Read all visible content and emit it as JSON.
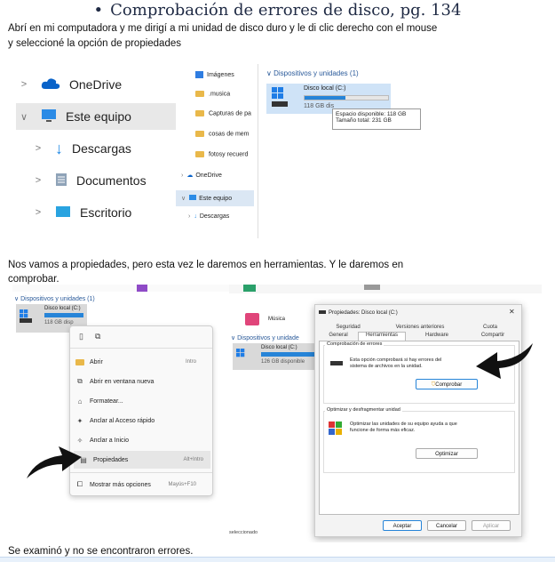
{
  "heading": {
    "bullet": "•",
    "title": "Comprobación de errores de disco, pg. 134"
  },
  "paragraphs": {
    "p1_line1": "Abrí en mi computadora y me dirigí a mi unidad de disco duro y le di clic derecho con el mouse",
    "p1_line2": "y seleccioné la opción de propiedades",
    "p2_line1": "Nos vamos a propiedades, pero esta vez le daremos en herramientas. Y le daremos en",
    "p2_line2": "comprobar.",
    "p3": "Se examinó y no se encontraron errores."
  },
  "explorer_big": {
    "items": [
      {
        "label": "OneDrive",
        "chevron": ">"
      },
      {
        "label": "Este equipo",
        "chevron": "∨"
      },
      {
        "label": "Descargas",
        "chevron": ">"
      },
      {
        "label": "Documentos",
        "chevron": ">"
      },
      {
        "label": "Escritorio",
        "chevron": ">"
      }
    ]
  },
  "explorer_small": {
    "items": [
      "Imágenes",
      ".musica",
      "Capturas de pa",
      "cosas de mem",
      "fotosy recuerd"
    ],
    "onedrive": "OneDrive",
    "este_equipo": "Este equipo",
    "descargas": "Descargas"
  },
  "devices_panel": {
    "section": "Dispositivos y unidades (1)",
    "drive_name": "Disco local (C:)",
    "drive_free_short": "118 GB dis",
    "tooltip_free": "Espacio disponible: 118 GB",
    "tooltip_total": "Tamaño total: 231 GB",
    "fill_fraction": 0.49
  },
  "context_shot": {
    "section": "Dispositivos y unidades (1)",
    "drive_name": "Disco local (C:)",
    "drive_free_short": "118 GB disp",
    "menu": [
      {
        "label": "Abrir",
        "shortcut": "Intro",
        "icon": "folder-icon"
      },
      {
        "label": "Abrir en ventana nueva",
        "shortcut": "",
        "icon": "new-window-icon"
      },
      {
        "label": "Formatear...",
        "shortcut": "",
        "icon": "format-icon"
      },
      {
        "label": "Anclar al Acceso rápido",
        "shortcut": "",
        "icon": "pin-icon"
      },
      {
        "label": "Anclar a Inicio",
        "shortcut": "",
        "icon": "pin-start-icon"
      },
      {
        "label": "Propiedades",
        "shortcut": "Alt+Intro",
        "icon": "properties-icon"
      },
      {
        "label": "Mostrar más opciones",
        "shortcut": "Mayús+F10",
        "icon": "more-options-icon"
      }
    ]
  },
  "props_shot": {
    "bg_musica": "Música",
    "bg_section": "Dispositivos y unidade",
    "bg_drive": "Disco local (C:)",
    "bg_free": "126 GB disponible",
    "bg_status": "seleccionado",
    "title": "Propiedades: Disco local (C:)",
    "close": "✕",
    "tabs_row1": [
      "Seguridad",
      "Versiones anteriores",
      "Cuota"
    ],
    "tabs_row2": [
      "General",
      "Herramientas",
      "Hardware",
      "Compartir"
    ],
    "group1_title": "Comprobación de errores",
    "group1_text_1": "Esta opción comprobará si hay errores del",
    "group1_text_2": "sistema de archivos en la unidad.",
    "check_button": "Comprobar",
    "group2_title": "Optimizar y desfragmentar unidad",
    "group2_text_1": "Optimizar las unidades de su equipo ayuda a que",
    "group2_text_2": "funcione de forma más eficaz.",
    "optimize_button": "Optimizar",
    "ok_button": "Aceptar",
    "cancel_button": "Cancelar",
    "apply_button": "Aplicar"
  },
  "colors": {
    "accent": "#1a73d9",
    "arrow": "#111111",
    "heading": "#1f2a44"
  }
}
